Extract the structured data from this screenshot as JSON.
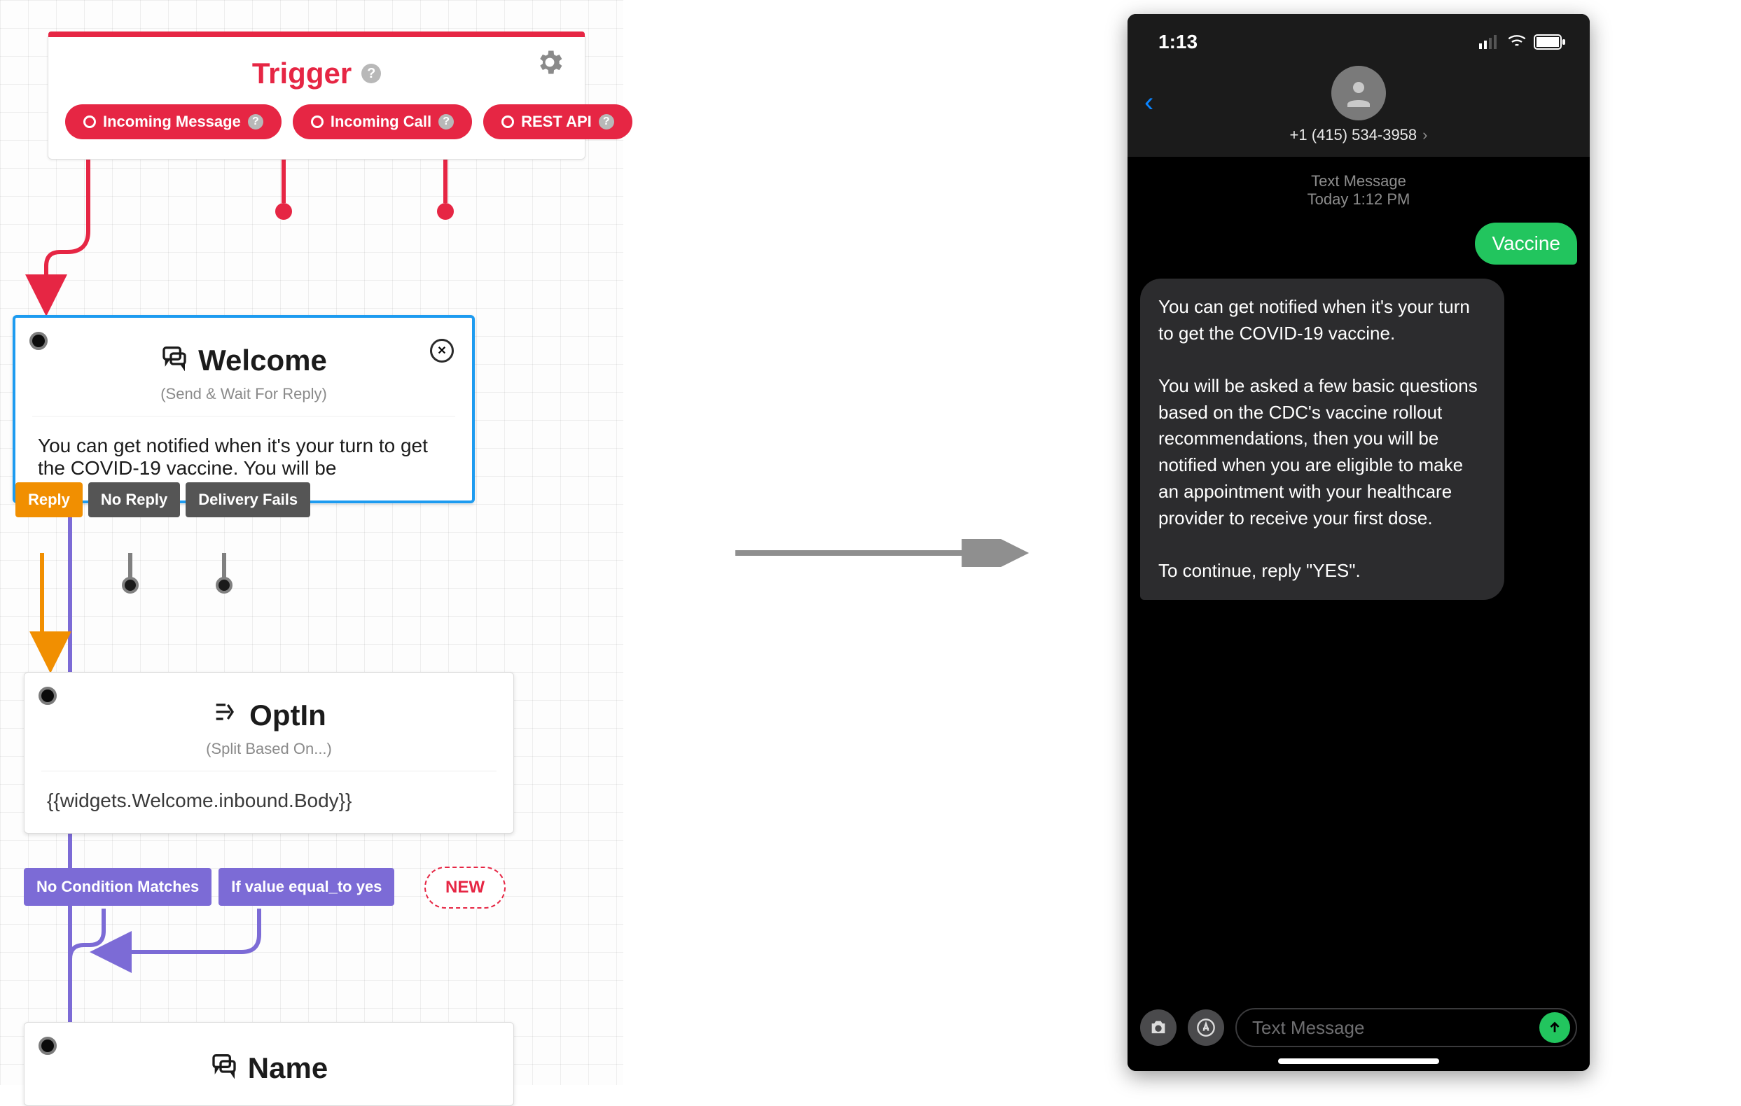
{
  "flow": {
    "trigger": {
      "title": "Trigger",
      "pills": {
        "incoming_message": "Incoming Message",
        "incoming_call": "Incoming Call",
        "rest_api": "REST API"
      }
    },
    "welcome": {
      "title": "Welcome",
      "subtitle": "(Send & Wait For Reply)",
      "body": "You can get notified when it's your turn to get the COVID-19 vaccine. You will be",
      "tabs": {
        "reply": "Reply",
        "no_reply": "No Reply",
        "delivery_fails": "Delivery Fails"
      }
    },
    "optin": {
      "title": "OptIn",
      "subtitle": "(Split Based On...)",
      "body": "{{widgets.Welcome.inbound.Body}}",
      "chips": {
        "no_match": "No Condition Matches",
        "eq_yes": "If value equal_to yes",
        "new": "NEW"
      }
    },
    "name": {
      "title": "Name"
    }
  },
  "phone": {
    "time": "1:13",
    "contact": "+1 (415) 534-3958",
    "meta_line1": "Text Message",
    "meta_line2": "Today 1:12 PM",
    "outgoing": "Vaccine",
    "incoming": "You can get notified when it's your turn to get the COVID-19 vaccine.\n\nYou will be asked a few basic questions based on the CDC's vaccine rollout recommendations, then you will be notified when you are eligible to make an appointment with your healthcare provider to receive your first dose.\n\nTo continue, reply \"YES\".",
    "compose_placeholder": "Text Message"
  }
}
